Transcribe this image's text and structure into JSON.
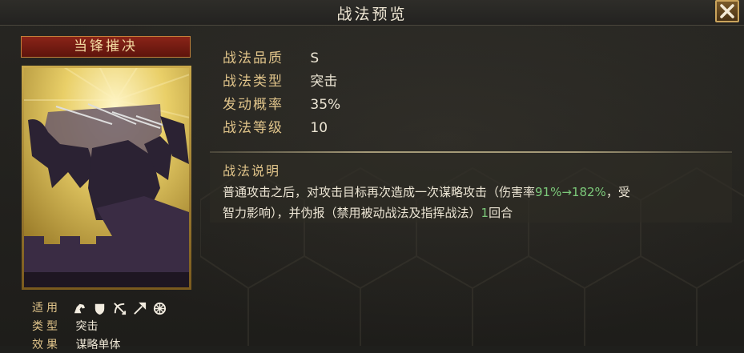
{
  "header": {
    "title": "战法预览"
  },
  "card": {
    "name": "当锋摧决",
    "meta": [
      {
        "label": "适用",
        "value": ""
      },
      {
        "label": "类型",
        "value": "突击"
      },
      {
        "label": "效果",
        "value": "谋略单体"
      }
    ],
    "unit_icons": [
      "cavalry-icon",
      "shield-icon",
      "archer-icon",
      "spear-icon",
      "siege-icon"
    ]
  },
  "stats": [
    {
      "label": "战法品质",
      "value": "S"
    },
    {
      "label": "战法类型",
      "value": "突击"
    },
    {
      "label": "发动概率",
      "value": "35%"
    },
    {
      "label": "战法等级",
      "value": "10"
    }
  ],
  "description": {
    "header": "战法说明",
    "line1_a": "普通攻击之后，对攻击目标再次造成一次谋略攻击（伤害率",
    "line1_hl": "91%→182%",
    "line1_b": "，受",
    "line2_a": "智力影响），并伪报（禁用被动战法及指挥战法）",
    "line2_hl": "1",
    "line2_b": "回合"
  },
  "colors": {
    "gold_label": "#e0c48a",
    "highlight_green": "#7cc97a",
    "card_title_red": "#8a2418"
  }
}
